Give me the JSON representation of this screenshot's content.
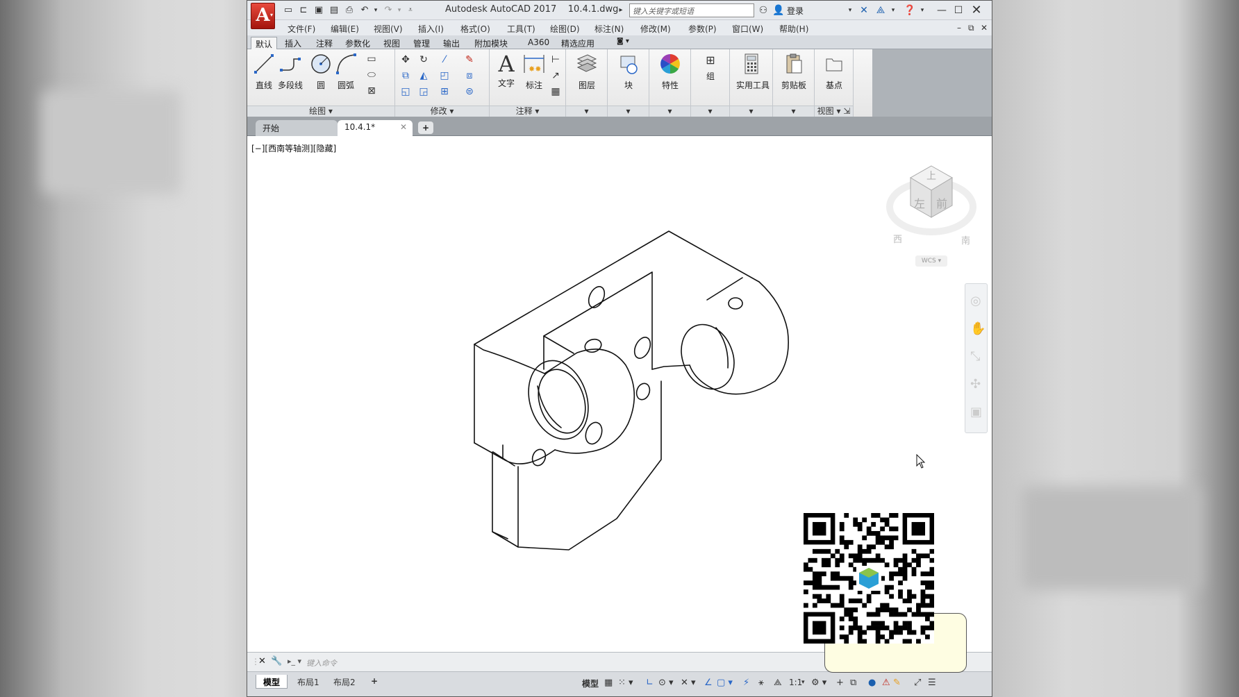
{
  "window": {
    "title": "Autodesk AutoCAD 2017",
    "filename": "10.4.1.dwg",
    "search_placeholder": "键入关键字或短语",
    "login": "登录"
  },
  "menus": [
    "文件(F)",
    "编辑(E)",
    "视图(V)",
    "插入(I)",
    "格式(O)",
    "工具(T)",
    "绘图(D)",
    "标注(N)",
    "修改(M)",
    "参数(P)",
    "窗口(W)",
    "帮助(H)"
  ],
  "ribbon_tabs": [
    "默认",
    "插入",
    "注释",
    "参数化",
    "视图",
    "管理",
    "输出",
    "附加模块",
    "A360",
    "精选应用"
  ],
  "ribbon": {
    "draw": {
      "title": "绘图",
      "line": "直线",
      "polyline": "多段线",
      "circle": "圆",
      "arc": "圆弧"
    },
    "modify": {
      "title": "修改"
    },
    "annotation": {
      "title": "注释",
      "text": "文字",
      "dimension": "标注"
    },
    "layers": "图层",
    "block": "块",
    "properties": "特性",
    "groups": "组",
    "utilities": "实用工具",
    "clipboard": "剪贴板",
    "view": {
      "title": "视图",
      "basepoint": "基点"
    }
  },
  "doc_tabs": [
    "开始",
    "10.4.1*"
  ],
  "viewport_label": "[−][西南等轴测][隐藏]",
  "viewcube": {
    "top": "上",
    "left": "左",
    "front": "前",
    "west": "西",
    "south": "南",
    "wcs": "WCS"
  },
  "command": {
    "placeholder": "键入命令"
  },
  "layout_tabs": [
    "模型",
    "布局1",
    "布局2"
  ],
  "status": {
    "model": "模型",
    "scale": "1:1"
  },
  "colors": {
    "accent": "#c0261a",
    "titlebar": "#e7eaee",
    "ribbon": "#eeeeee",
    "canvas": "#ffffff"
  }
}
